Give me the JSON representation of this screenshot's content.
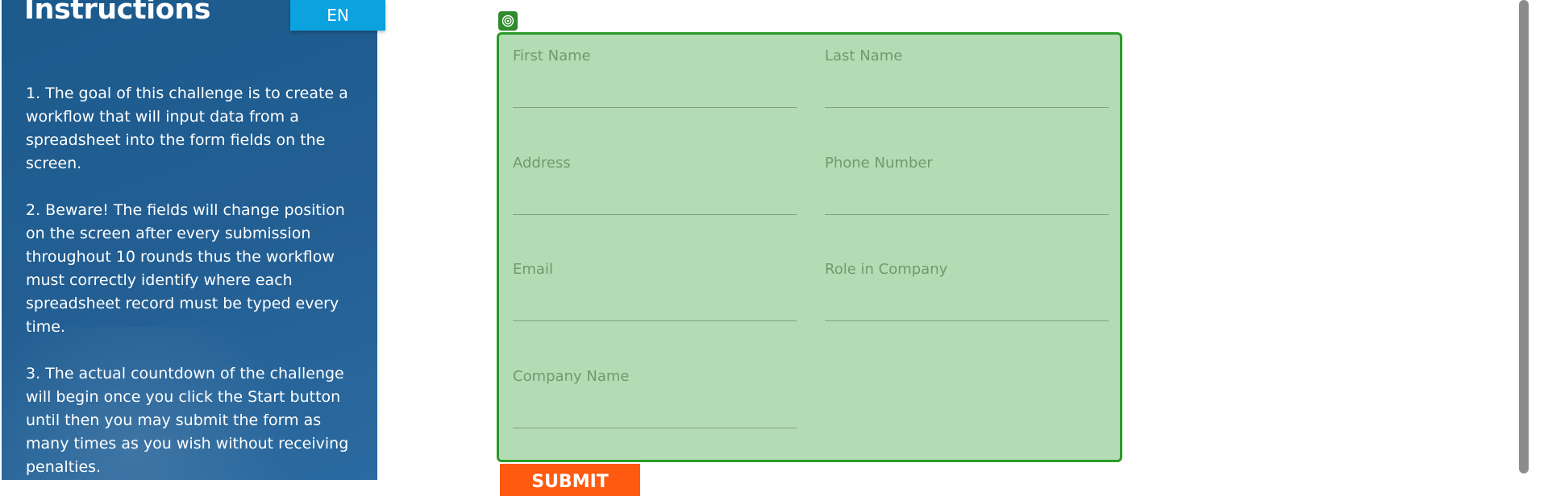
{
  "sidebar": {
    "title": "Instructions",
    "language_button": "EN",
    "steps": [
      "1. The goal of this challenge is to create a workflow that will input data from a spreadsheet into the form fields on the screen.",
      "2. Beware! The fields will change position on the screen after every submission throughout 10 rounds thus the workflow must correctly identify where each spreadsheet record must be typed every time.",
      "3. The actual countdown of the challenge will begin once you click the Start button until then you may submit the form as many times as you wish without receiving penalties."
    ]
  },
  "form": {
    "marker_icon": "target-icon",
    "fields": [
      {
        "label": "First Name",
        "value": ""
      },
      {
        "label": "Last Name",
        "value": ""
      },
      {
        "label": "Address",
        "value": ""
      },
      {
        "label": "Phone Number",
        "value": ""
      },
      {
        "label": "Email",
        "value": ""
      },
      {
        "label": "Role in Company",
        "value": ""
      },
      {
        "label": "Company Name",
        "value": ""
      }
    ],
    "submit_label": "SUBMIT"
  },
  "colors": {
    "sidebar_bg": "#1f5d91",
    "lang_button_bg": "#0aa3e0",
    "form_bg": "#b4dcb4",
    "form_border": "#2a9a2a",
    "submit_bg": "#ff5a10"
  }
}
